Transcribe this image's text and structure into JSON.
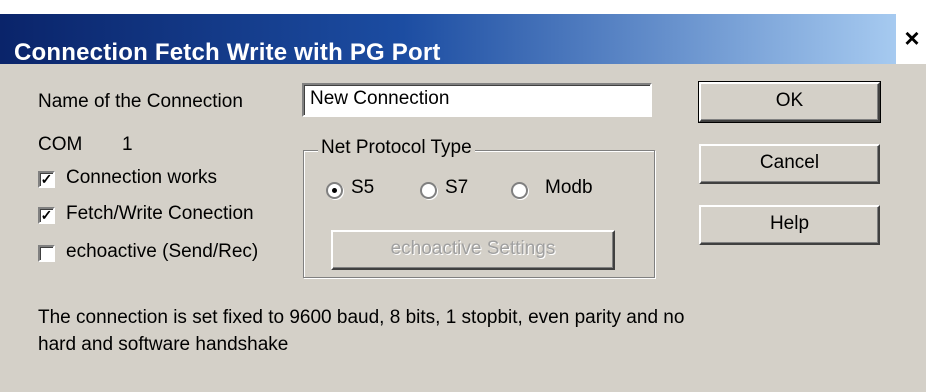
{
  "window": {
    "title": "Connection Fetch Write with PG Port",
    "close_symbol": "×"
  },
  "form": {
    "name_label": "Name of the Connection",
    "name_value": "New Connection",
    "com_label": "COM",
    "com_value": "1"
  },
  "checkboxes": [
    {
      "label": "Connection works",
      "checked": true
    },
    {
      "label": "Fetch/Write Conection",
      "checked": true
    },
    {
      "label": "echoactive (Send/Rec)",
      "checked": false
    }
  ],
  "protocol": {
    "group_title": "Net Protocol Type",
    "options": [
      {
        "label": "S5",
        "selected": true
      },
      {
        "label": "S7",
        "selected": false
      },
      {
        "label": "Modb",
        "selected": false
      }
    ]
  },
  "buttons": {
    "ok": "OK",
    "cancel": "Cancel",
    "help": "Help",
    "echo_settings": "echoactive Settings"
  },
  "info_text": "The connection is set fixed to 9600 baud, 8 bits, 1 stopbit, even parity and no hard and software handshake",
  "colors": {
    "title_start": "#0a246a",
    "title_end": "#a6caf0",
    "dialog_bg": "#d4d0c8"
  }
}
